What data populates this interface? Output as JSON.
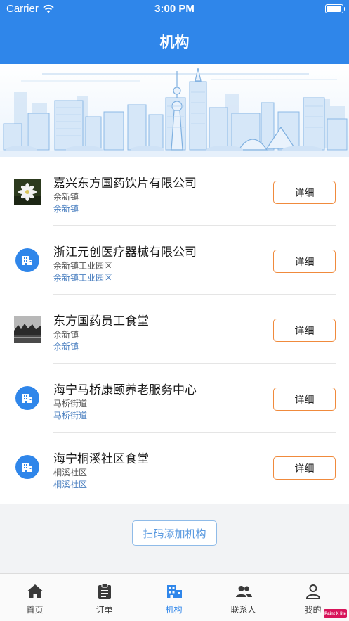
{
  "status_bar": {
    "carrier": "Carrier",
    "time": "3:00 PM"
  },
  "header": {
    "title": "机构"
  },
  "banner": {
    "image": "city-skyline-illustration"
  },
  "organizations": [
    {
      "name": "嘉兴东方国药饮片有限公司",
      "line1": "余新镇",
      "line2": "余新镇",
      "thumbnail": "flower-photo",
      "detail_label": "详细"
    },
    {
      "name": "浙江元创医疗器械有限公司",
      "line1": "余新镇工业园区",
      "line2": "余新镇工业园区",
      "thumbnail": "building-icon",
      "detail_label": "详细"
    },
    {
      "name": "东方国药员工食堂",
      "line1": "余新镇",
      "line2": "余新镇",
      "thumbnail": "landscape-photo",
      "detail_label": "详细"
    },
    {
      "name": "海宁马桥康颐养老服务中心",
      "line1": "马桥街道",
      "line2": "马桥街道",
      "thumbnail": "building-icon",
      "detail_label": "详细"
    },
    {
      "name": "海宁桐溪社区食堂",
      "line1": "桐溪社区",
      "line2": "桐溪社区",
      "thumbnail": "building-icon",
      "detail_label": "详细"
    }
  ],
  "actions": {
    "scan_add": "扫码添加机构"
  },
  "tabbar": {
    "tabs": [
      {
        "label": "首页",
        "icon": "home-icon"
      },
      {
        "label": "订单",
        "icon": "clipboard-icon"
      },
      {
        "label": "机构",
        "icon": "building-icon",
        "active": true
      },
      {
        "label": "联系人",
        "icon": "contacts-icon"
      },
      {
        "label": "我的",
        "icon": "person-icon"
      }
    ]
  },
  "watermark": {
    "text": "Paint X lite"
  },
  "colors": {
    "primary": "#2f86ea",
    "accent_border": "#f08a3c",
    "background": "#f2f3f5"
  }
}
